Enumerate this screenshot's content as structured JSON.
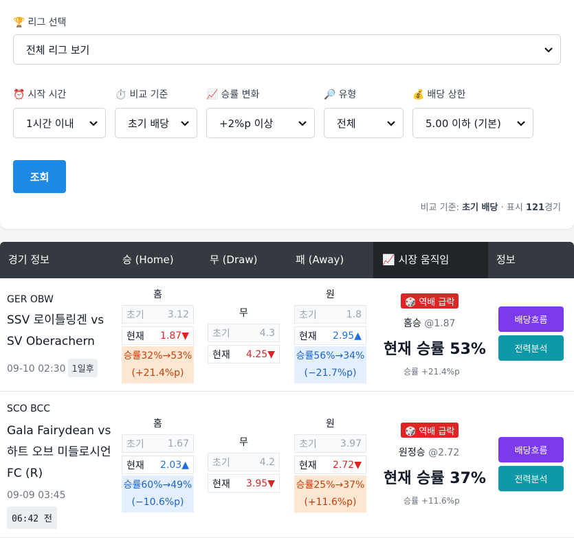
{
  "filters": {
    "league_label": "리그 선택",
    "league_icon": "trophy-icon",
    "league_value": "전체 리그 보기",
    "start_label": "시작 시간",
    "start_icon": "alarm-clock-icon",
    "start_value": "1시간 이내",
    "compare_label": "비교 기준",
    "compare_icon": "stopwatch-icon",
    "compare_value": "초기 배당",
    "winrate_label": "승률 변화",
    "winrate_icon": "chart-up-icon",
    "winrate_value": "+2%p 이상",
    "type_label": "유형",
    "type_icon": "magnifier-icon",
    "type_value": "전체",
    "odds_label": "배당 상한",
    "odds_icon": "money-bag-icon",
    "odds_value": "5.00 이하 (기본)",
    "search_button": "조회",
    "meta_prefix": "비교 기준: ",
    "meta_basis": "초기 배당",
    "meta_sep": " · 표시 ",
    "meta_count": "121",
    "meta_suffix": "경기"
  },
  "table": {
    "headers": {
      "match": "경기 정보",
      "home": "승 (Home)",
      "draw": "무 (Draw)",
      "away": "패 (Away)",
      "market": "📈 시장 움직임",
      "info": "정보"
    },
    "rows": [
      {
        "league": "GER OBW",
        "teams": "SSV 로이틀링겐 vs SV Oberachern",
        "kickoff": "09-10 02:30",
        "badge": "1일후",
        "home": {
          "label": "홈",
          "init_label": "초기",
          "init": "3.12",
          "cur_label": "현재",
          "cur": "1.87▼",
          "change_line1": "승률32%→53%",
          "change_line2": "(+21.4%p)"
        },
        "draw": {
          "label": "무",
          "init_label": "초기",
          "init": "4.3",
          "cur_label": "현재",
          "cur": "4.25▼"
        },
        "away": {
          "label": "원",
          "init_label": "초기",
          "init": "1.8",
          "cur_label": "현재",
          "cur": "2.95▲",
          "change_line1": "승률56%→34%",
          "change_line2": "(−21.7%p)"
        },
        "market": {
          "tag": "🎲 역배 급락",
          "pick": "홈승",
          "pick_odds": "@1.87",
          "rate": "현재 승률 53%",
          "rate_sub": "승률 +21.4%p"
        },
        "flow_button": "배당흐름",
        "analysis_button": "전력분석"
      },
      {
        "league": "SCO BCC",
        "teams": "Gala Fairydean vs 하트 오브 미들로시언 FC (R)",
        "kickoff": "09-09 03:45",
        "badge": "06:42 전",
        "home": {
          "label": "홈",
          "init_label": "초기",
          "init": "1.67",
          "cur_label": "현재",
          "cur": "2.03▲",
          "change_line1": "승률60%→49%",
          "change_line2": "(−10.6%p)"
        },
        "draw": {
          "label": "무",
          "init_label": "초기",
          "init": "4.2",
          "cur_label": "현재",
          "cur": "3.95▼"
        },
        "away": {
          "label": "원",
          "init_label": "초기",
          "init": "3.97",
          "cur_label": "현재",
          "cur": "2.72▼",
          "change_line1": "승률25%→37%",
          "change_line2": "(+11.6%p)"
        },
        "market": {
          "tag": "🎲 역배 급락",
          "pick": "원정승",
          "pick_odds": "@2.72",
          "rate": "현재 승률 37%",
          "rate_sub": "승률 +11.6%p"
        },
        "flow_button": "배당흐름",
        "analysis_button": "전력분석"
      }
    ]
  },
  "colors": {
    "primary": "#1e88e5",
    "purple": "#7c3aed",
    "teal": "#0e98a8",
    "red": "#dc2626",
    "blue": "#1e6fd9",
    "header": "#343a40"
  }
}
